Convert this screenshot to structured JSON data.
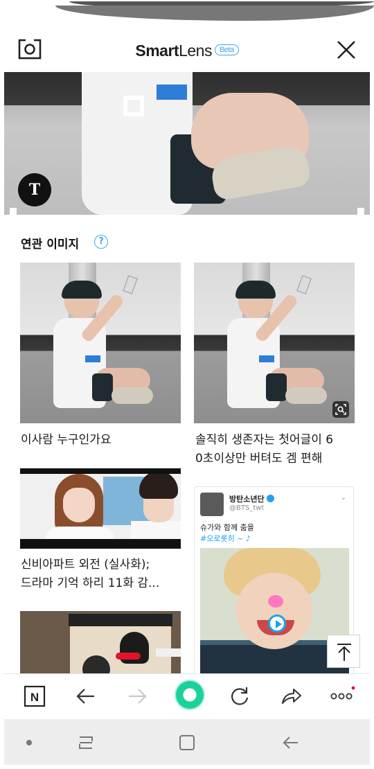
{
  "header": {
    "brand_bold": "Smart",
    "brand_light": "Lens",
    "beta_badge": "Beta"
  },
  "photo": {
    "text_button_label": "T"
  },
  "related": {
    "section_title": "연관 이미지",
    "help_icon": "?",
    "items": [
      {
        "caption": "이사람 누구인가요"
      },
      {
        "caption_line1": "솔직히 생존자는 첫어글이 6",
        "caption_line2": "0초이상만 버텨도 겜 편해"
      },
      {
        "caption_line1": "신비아파트 외전 (실사화);",
        "caption_line2": "드라마 기억 하리 11화 감..."
      }
    ]
  },
  "tweet": {
    "name": "방탄소년단",
    "handle": "@BTS_twt",
    "chevron": "⌄",
    "text": "슈가와 함께 춤을",
    "hashtag": "#오로롯히 ~ ♪"
  },
  "toolbar": {
    "n_button": "N",
    "more_button": "ooo"
  },
  "icons": {
    "camera": "camera-icon",
    "close": "close-icon",
    "help": "help-circle-icon",
    "lens": "lens-search-icon",
    "scroll_top": "arrow-up-icon",
    "back": "arrow-left-icon",
    "forward": "arrow-right-icon",
    "refresh": "refresh-icon",
    "share": "share-icon",
    "more": "more-icon"
  },
  "colors": {
    "accent": "#3ba6f0",
    "green": "#1bd19a",
    "notification": "#e0152a"
  }
}
